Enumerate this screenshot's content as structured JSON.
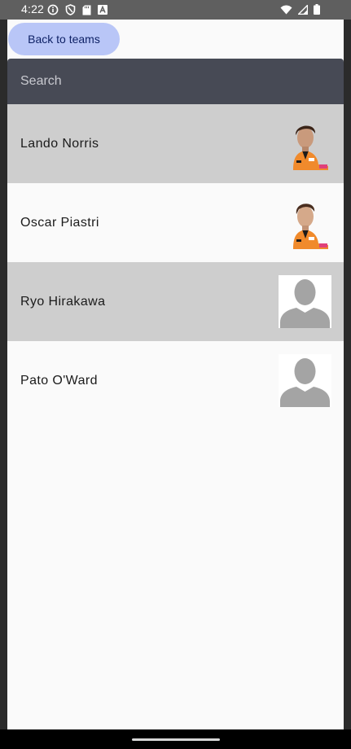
{
  "status_bar": {
    "time": "4:22",
    "left_icons": [
      "info-icon",
      "shield-icon",
      "sd-card-icon",
      "text-icon"
    ],
    "right_icons": [
      "wifi-icon",
      "signal-icon",
      "battery-icon"
    ]
  },
  "header": {
    "back_label": "Back to teams"
  },
  "search": {
    "placeholder": "Search",
    "value": ""
  },
  "drivers": [
    {
      "name": "Lando Norris",
      "photo": "driver-photo",
      "shaded": true
    },
    {
      "name": "Oscar Piastri",
      "photo": "driver-photo",
      "shaded": false
    },
    {
      "name": "Ryo Hirakawa",
      "photo": "placeholder-avatar",
      "shaded": true
    },
    {
      "name": "Pato O'Ward",
      "photo": "placeholder-avatar",
      "shaded": false
    }
  ],
  "colors": {
    "accent_button": "#b9c6f7",
    "search_bg": "#474a55",
    "row_shaded": "#cecece",
    "suit_orange": "#f08a2c"
  }
}
